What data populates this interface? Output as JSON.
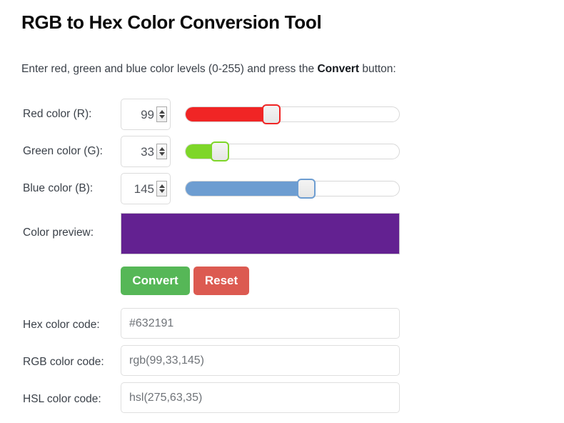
{
  "header": {
    "title": "RGB to Hex Color Conversion Tool"
  },
  "intro": {
    "before": "Enter red, green and blue color levels (0-255) and press the ",
    "emphasis": "Convert",
    "after": " button:"
  },
  "channels": [
    {
      "key": "red",
      "label": "Red color (R):",
      "value": "99",
      "number": 99,
      "slider_color": "#f02525",
      "handle_border": "#f02525",
      "fill_percent": 38.8,
      "handle_percent": 38.8
    },
    {
      "key": "green",
      "label": "Green color (G):",
      "value": "33",
      "number": 33,
      "slider_color": "#7ed629",
      "handle_border": "#7ed629",
      "fill_percent": 12.9,
      "handle_percent": 12.9
    },
    {
      "key": "blue",
      "label": "Blue color (B):",
      "value": "145",
      "number": 145,
      "slider_color": "#6d9dd1",
      "handle_border": "#6d9dd1",
      "fill_percent": 56.9,
      "handle_percent": 56.9
    }
  ],
  "preview": {
    "label": "Color preview:",
    "color": "#632191"
  },
  "buttons": {
    "convert": "Convert",
    "reset": "Reset",
    "convert_color": "#56b757",
    "reset_color": "#dc5a51"
  },
  "outputs": [
    {
      "key": "hex",
      "label": "Hex color code:",
      "value": "#632191"
    },
    {
      "key": "rgb",
      "label": "RGB color code:",
      "value": "rgb(99,33,145)"
    },
    {
      "key": "hsl",
      "label": "HSL color code:",
      "value": "hsl(275,63,35)"
    }
  ]
}
